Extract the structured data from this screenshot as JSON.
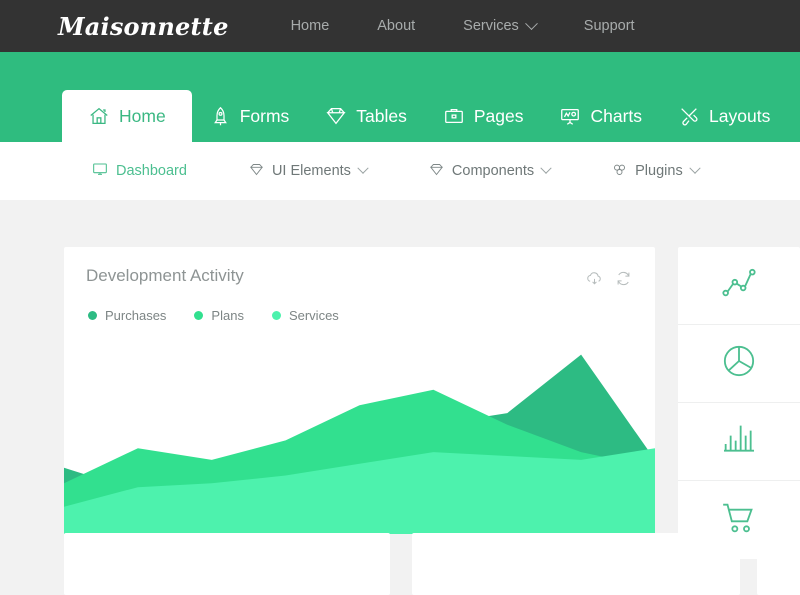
{
  "brand": {
    "name": "Maisonnette"
  },
  "topnav": {
    "items": [
      {
        "label": "Home",
        "caret": false
      },
      {
        "label": "About",
        "caret": false
      },
      {
        "label": "Services",
        "caret": true
      },
      {
        "label": "Support",
        "caret": false
      }
    ]
  },
  "tabs": {
    "items": [
      {
        "label": "Home",
        "icon": "home-icon",
        "active": true
      },
      {
        "label": "Forms",
        "icon": "rocket-icon",
        "active": false
      },
      {
        "label": "Tables",
        "icon": "diamond-icon",
        "active": false
      },
      {
        "label": "Pages",
        "icon": "briefcase-icon",
        "active": false
      },
      {
        "label": "Charts",
        "icon": "whiteboard-icon",
        "active": false
      },
      {
        "label": "Layouts",
        "icon": "tools-icon",
        "active": false
      }
    ]
  },
  "subnav": {
    "items": [
      {
        "label": "Dashboard",
        "icon": "monitor-icon",
        "caret": false,
        "active": true
      },
      {
        "label": "UI Elements",
        "icon": "diamond-icon",
        "caret": true,
        "active": false
      },
      {
        "label": "Components",
        "icon": "diamond-icon",
        "caret": true,
        "active": false
      },
      {
        "label": "Plugins",
        "icon": "puzzle-icon",
        "caret": true,
        "active": false
      }
    ]
  },
  "card": {
    "title": "Development Activity",
    "actions": [
      {
        "name": "cloud-download-icon",
        "label": "Download"
      },
      {
        "name": "refresh-icon",
        "label": "Refresh"
      }
    ]
  },
  "rail": {
    "items": [
      {
        "icon": "line-chart-icon",
        "label": "Line chart"
      },
      {
        "icon": "pie-chart-icon",
        "label": "Pie chart"
      },
      {
        "icon": "bar-chart-icon",
        "label": "Bar chart"
      },
      {
        "icon": "cart-icon",
        "label": "Cart"
      }
    ]
  },
  "colors": {
    "dark_header": "#333333",
    "brand_green": "#2fbc7f",
    "accent_green": "#4cbf90",
    "purchases": "#2dbb83",
    "plans": "#32e08f",
    "services": "#4df2ad",
    "page_bg": "#f2f2f2",
    "card_bg": "#ffffff"
  },
  "chart_data": {
    "type": "area",
    "title": "Development Activity",
    "stacked": false,
    "grid": false,
    "legend_position": "top-left",
    "xlabel": "",
    "ylabel": "",
    "x": [
      0,
      1,
      2,
      3,
      4,
      5,
      6,
      7,
      8
    ],
    "xlim": [
      0,
      8
    ],
    "ylim": [
      0,
      100
    ],
    "series": [
      {
        "name": "Purchases",
        "color": "#2dbb83",
        "values": [
          34,
          22,
          16,
          20,
          30,
          56,
          62,
          92,
          38
        ]
      },
      {
        "name": "Plans",
        "color": "#32e08f",
        "values": [
          26,
          44,
          38,
          48,
          66,
          74,
          56,
          42,
          34
        ]
      },
      {
        "name": "Services",
        "color": "#4df2ad",
        "values": [
          14,
          24,
          26,
          30,
          36,
          42,
          40,
          38,
          44
        ]
      }
    ]
  }
}
